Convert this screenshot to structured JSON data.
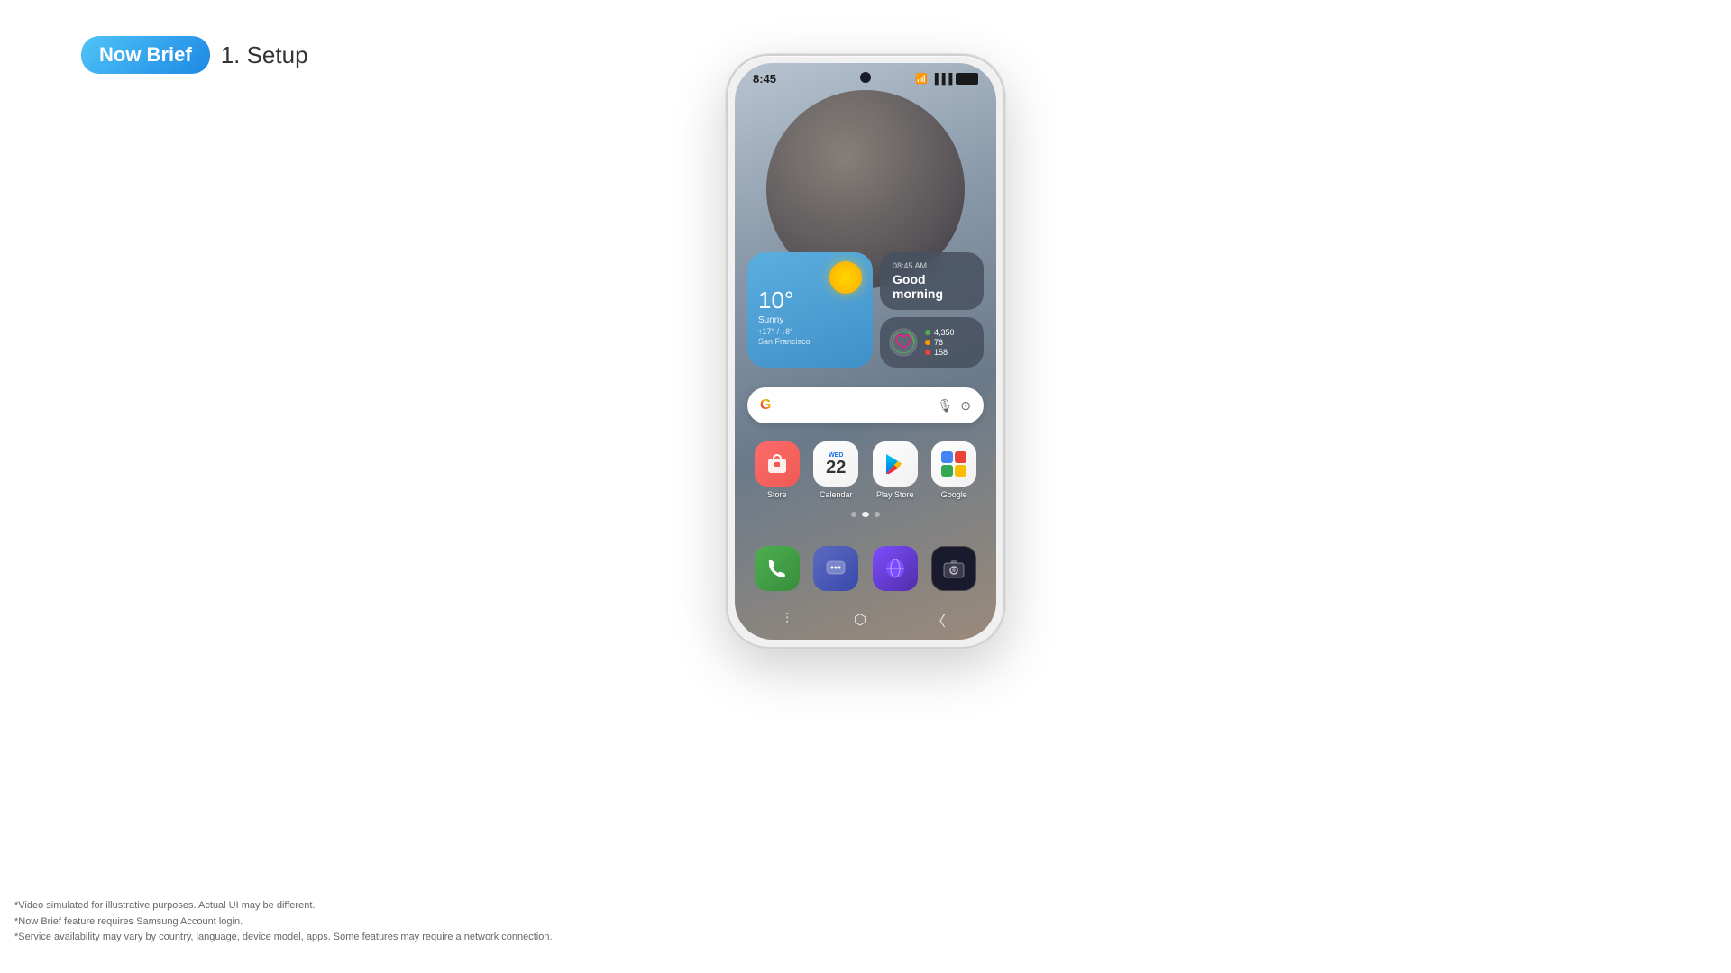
{
  "header": {
    "badge_text": "Now Brief",
    "step_text": "1. Setup"
  },
  "phone": {
    "status_bar": {
      "time": "8:45",
      "battery": "100"
    },
    "widgets": {
      "weather": {
        "temperature": "10°",
        "condition": "Sunny",
        "range": "↑17° / ↓8°",
        "city": "San Francisco"
      },
      "morning": {
        "time": "08:45 AM",
        "greeting": "Good morning"
      },
      "health": {
        "steps": "4,350",
        "active_minutes": "76",
        "calories": "158"
      }
    },
    "search_bar": {
      "google_label": "G"
    },
    "apps": [
      {
        "label": "Store",
        "icon": "store"
      },
      {
        "label": "Calendar",
        "icon": "calendar",
        "day": "WED",
        "date": "22"
      },
      {
        "label": "Play Store",
        "icon": "playstore"
      },
      {
        "label": "Google",
        "icon": "google"
      }
    ],
    "dock": [
      {
        "label": "Phone",
        "icon": "phone"
      },
      {
        "label": "Messages",
        "icon": "messages"
      },
      {
        "label": "Browser",
        "icon": "browser"
      },
      {
        "label": "Camera",
        "icon": "camera"
      }
    ]
  },
  "footer_notes": [
    "*Video simulated for illustrative purposes. Actual UI may be different.",
    "*Now Brief feature requires Samsung Account login.",
    "*Service availability may vary by country, language, device model, apps. Some features may require a network connection."
  ]
}
